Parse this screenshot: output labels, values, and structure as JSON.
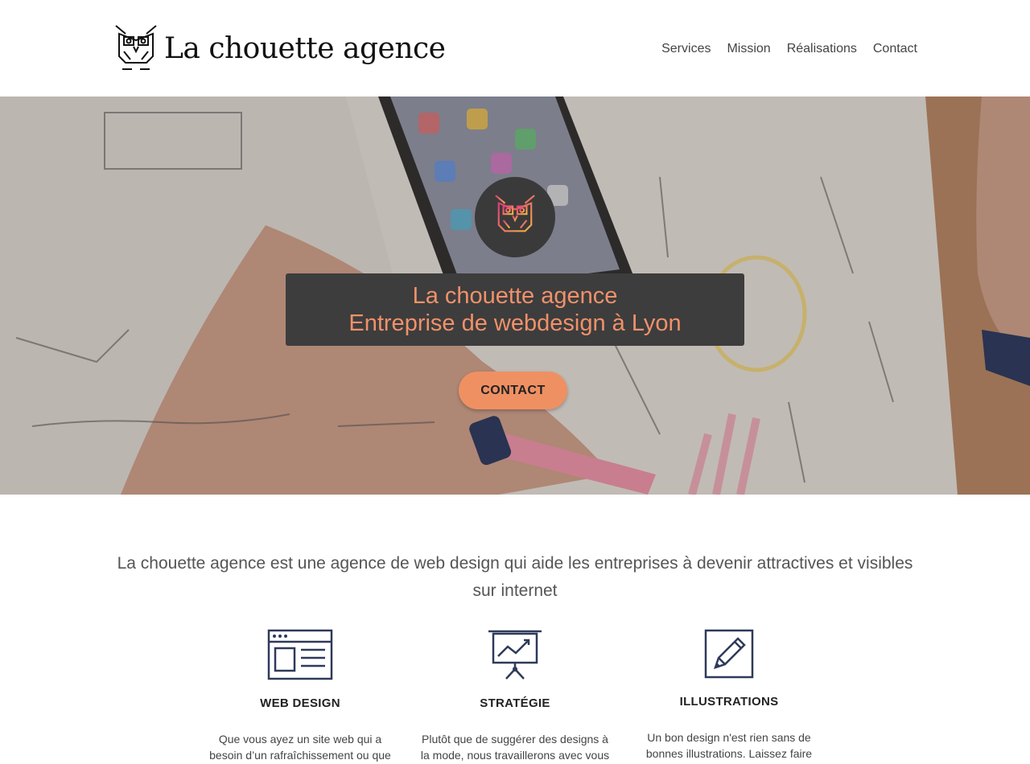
{
  "header": {
    "logo_text": "La chouette agence",
    "nav": [
      "Services",
      "Mission",
      "Réalisations",
      "Contact"
    ]
  },
  "hero": {
    "title_line1": "La chouette agence",
    "title_line2": "Entreprise de webdesign à Lyon",
    "cta_label": "CONTACT",
    "icon": "owl-logo-icon"
  },
  "intro": {
    "text": "La chouette agence est une agence de web design qui aide les entreprises à devenir attractives et visibles sur internet"
  },
  "services": [
    {
      "title": "WEB DESIGN",
      "icon": "web-page-icon",
      "text": "Que vous ayez un site web qui a besoin d’un rafraîchissement ou que"
    },
    {
      "title": "STRATÉGIE",
      "icon": "presentation-chart-icon",
      "text": "Plutôt que de suggérer des designs à la mode, nous travaillerons avec vous"
    },
    {
      "title": "ILLUSTRATIONS",
      "icon": "pencil-icon",
      "text": "Un bon design n'est rien sans de bonnes illustrations. Laissez faire"
    }
  ],
  "colors": {
    "accent": "#ef9063",
    "title_box": "#3d3d3d",
    "icon_stroke": "#2e3a5a"
  }
}
